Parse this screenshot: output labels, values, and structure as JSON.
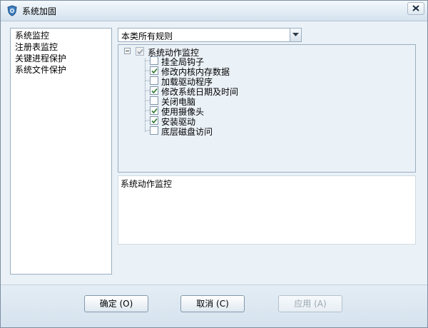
{
  "window": {
    "title": "系统加固"
  },
  "left_menu": {
    "items": [
      {
        "label": "系统监控"
      },
      {
        "label": "注册表监控"
      },
      {
        "label": "关键进程保护"
      },
      {
        "label": "系统文件保护"
      }
    ]
  },
  "rule_filter": {
    "selected": "本类所有规则"
  },
  "tree": {
    "root": {
      "label": "系统动作监控",
      "checked": true,
      "expanded": true
    },
    "children": [
      {
        "label": "挂全局钩子",
        "checked": false
      },
      {
        "label": "修改内核内存数据",
        "checked": true
      },
      {
        "label": "加载驱动程序",
        "checked": false
      },
      {
        "label": "修改系统日期及时间",
        "checked": true
      },
      {
        "label": "关闭电脑",
        "checked": false
      },
      {
        "label": "使用摄像头",
        "checked": true
      },
      {
        "label": "安装驱动",
        "checked": true
      },
      {
        "label": "底层磁盘访问",
        "checked": false
      }
    ]
  },
  "description": {
    "text": "系统动作监控"
  },
  "buttons": {
    "ok": "确定 (O)",
    "cancel": "取消 (C)",
    "apply": "应用 (A)"
  },
  "colors": {
    "accent": "#eaf1f7",
    "border": "#9aaebf",
    "check": "#2a7a2a"
  },
  "icons": {
    "app": "shield-icon",
    "close": "close-icon",
    "dropdown": "chevron-down-icon"
  }
}
